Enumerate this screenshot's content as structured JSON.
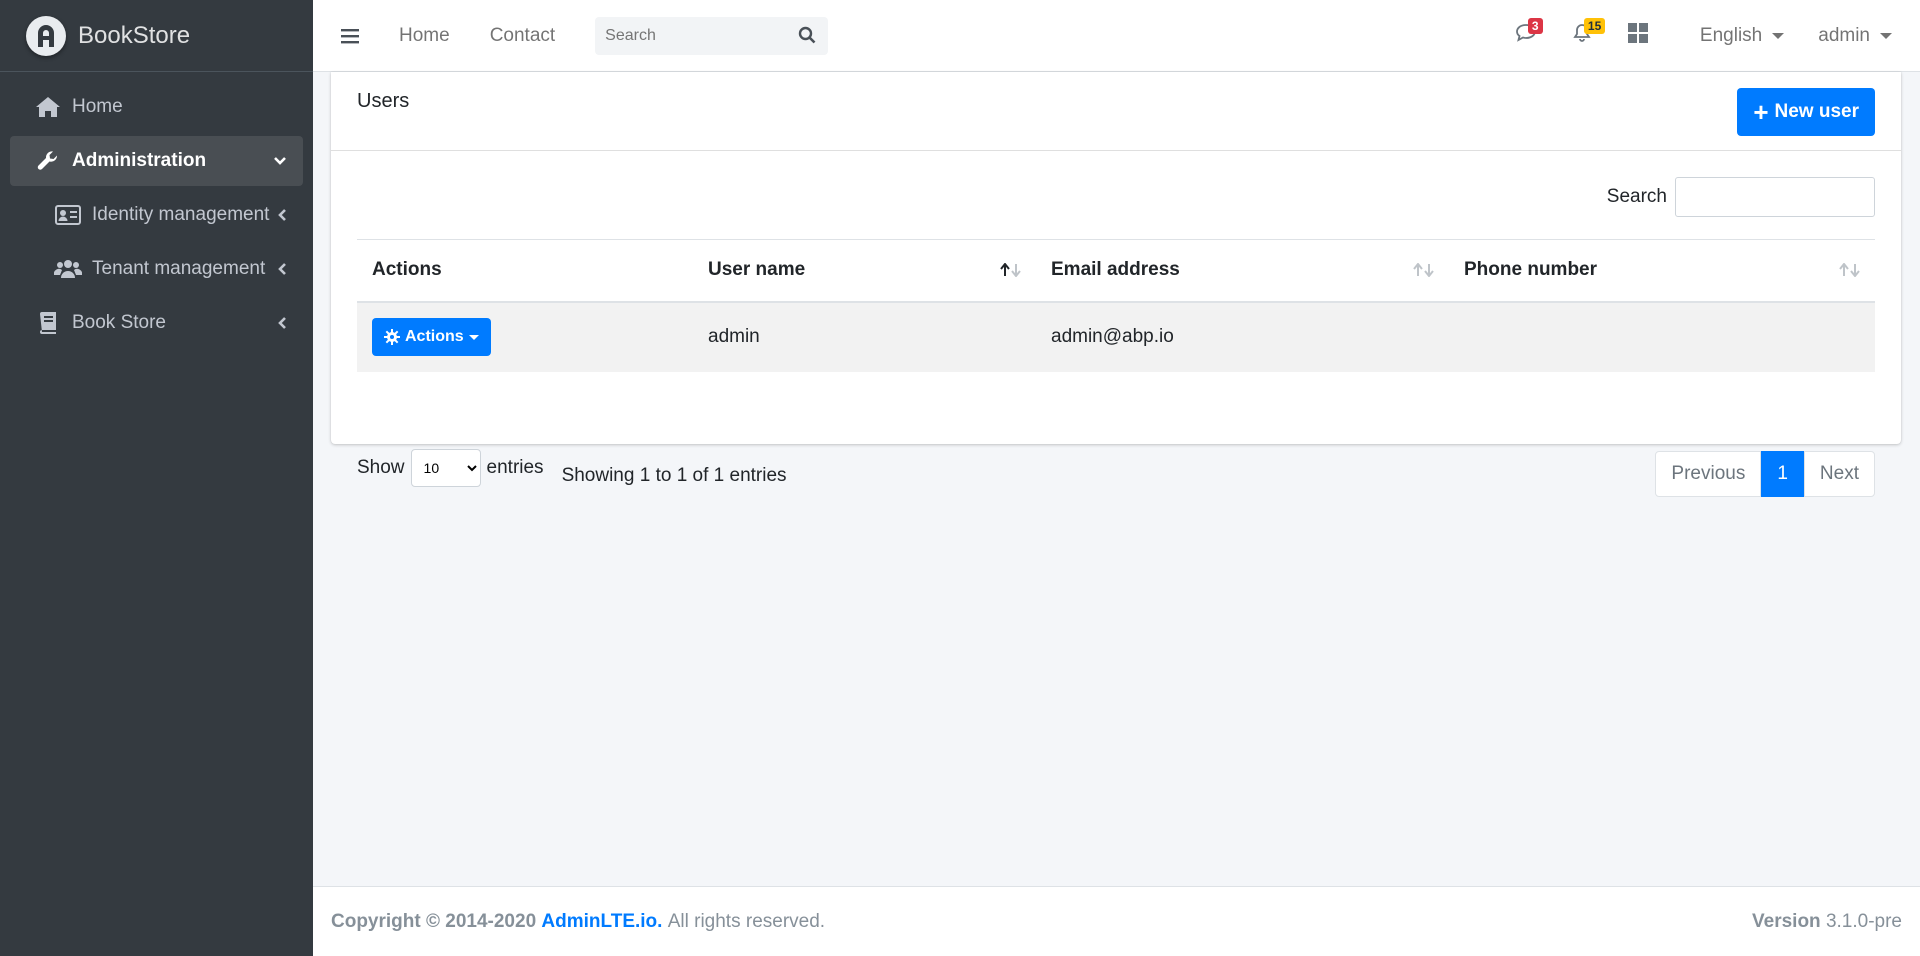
{
  "brand": {
    "name": "BookStore"
  },
  "sidebar": {
    "items": [
      {
        "label": "Home"
      },
      {
        "label": "Administration"
      },
      {
        "label": "Identity management"
      },
      {
        "label": "Tenant management"
      },
      {
        "label": "Book Store"
      }
    ]
  },
  "navbar": {
    "links": [
      "Home",
      "Contact"
    ],
    "search_placeholder": "Search",
    "messages_count": "3",
    "notifications_count": "15",
    "language": "English",
    "user": "admin"
  },
  "card": {
    "title": "Users",
    "new_user_label": "New user",
    "filter_label": "Search",
    "table": {
      "columns": [
        "Actions",
        "User name",
        "Email address",
        "Phone number"
      ],
      "rows": [
        {
          "actions_label": "Actions",
          "user_name": "admin",
          "email": "admin@abp.io",
          "phone": ""
        }
      ]
    },
    "length": {
      "show": "Show",
      "value": "10",
      "entries": "entries"
    },
    "info": "Showing 1 to 1 of 1 entries",
    "pagination": {
      "previous": "Previous",
      "current": "1",
      "next": "Next"
    }
  },
  "footer": {
    "copyright_prefix": "Copyright © 2014-2020",
    "link": "AdminLTE.io.",
    "suffix": "All rights reserved.",
    "version_label": "Version",
    "version": "3.1.0-pre"
  },
  "colors": {
    "primary": "#007bff",
    "sidebar": "#343a40",
    "danger": "#dc3545",
    "warning": "#ffc107"
  }
}
